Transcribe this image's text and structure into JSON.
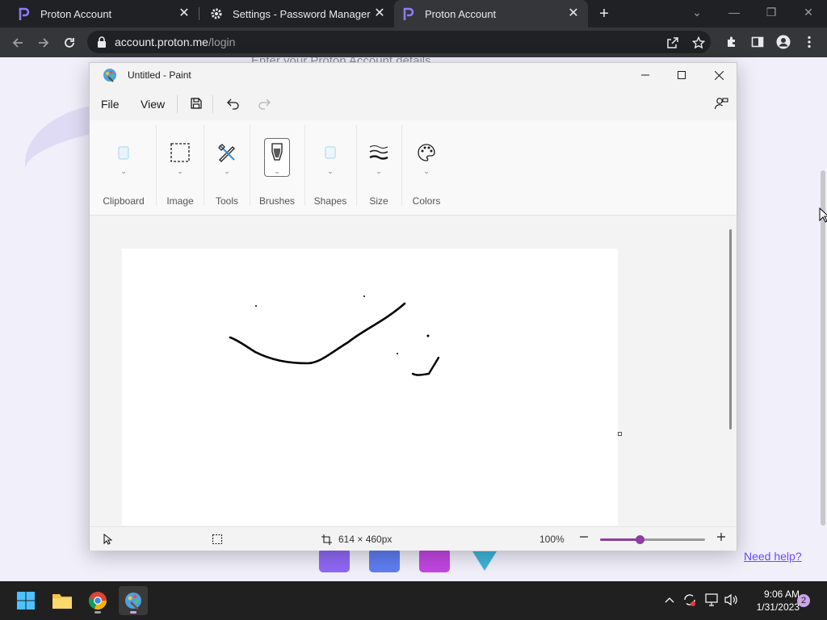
{
  "browser": {
    "tabs": [
      {
        "title": "Proton Account",
        "active": false
      },
      {
        "title": "Settings - Password Manager",
        "active": false
      },
      {
        "title": "Proton Account",
        "active": true
      }
    ],
    "url_host": "account.proton.me",
    "url_path": "/login"
  },
  "page": {
    "hint_text": "Enter your Proton Account details",
    "need_help": "Need help?"
  },
  "paint": {
    "title": "Untitled - Paint",
    "menu": {
      "file": "File",
      "view": "View"
    },
    "ribbon": {
      "clipboard": "Clipboard",
      "image": "Image",
      "tools": "Tools",
      "brushes": "Brushes",
      "shapes": "Shapes",
      "size": "Size",
      "colors": "Colors"
    },
    "status": {
      "canvas_size": "614 × 460px",
      "zoom": "100%",
      "zoom_level": 0.38
    },
    "colors": {
      "accent": "#8b3fa0"
    }
  },
  "taskbar": {
    "time": "9:06 AM",
    "date": "1/31/2023",
    "notifications": "2"
  }
}
